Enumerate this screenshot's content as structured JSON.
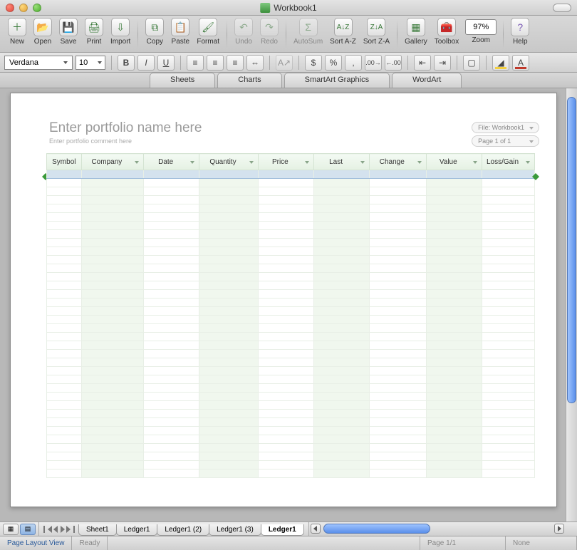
{
  "window": {
    "title": "Workbook1"
  },
  "toolbar": {
    "new": "New",
    "open": "Open",
    "save": "Save",
    "print": "Print",
    "import": "Import",
    "copy": "Copy",
    "paste": "Paste",
    "format": "Format",
    "undo": "Undo",
    "redo": "Redo",
    "autosum": "AutoSum",
    "sortaz": "Sort A-Z",
    "sortza": "Sort Z-A",
    "gallery": "Gallery",
    "toolbox": "Toolbox",
    "zoom": "Zoom",
    "zoom_value": "97%",
    "help": "Help"
  },
  "format": {
    "font_name": "Verdana",
    "font_size": "10"
  },
  "ribbon": {
    "sheets": "Sheets",
    "charts": "Charts",
    "smartart": "SmartArt Graphics",
    "wordart": "WordArt"
  },
  "portfolio": {
    "title_placeholder": "Enter portfolio name here",
    "comment_placeholder": "Enter portfolio comment here",
    "file_pill": "File: Workbook1",
    "page_pill": "Page 1 of 1"
  },
  "columns": {
    "symbol": "Symbol",
    "company": "Company",
    "date": "Date",
    "quantity": "Quantity",
    "price": "Price",
    "last": "Last",
    "change": "Change",
    "value": "Value",
    "lossgain": "Loss/Gain"
  },
  "sheets": {
    "tabs": [
      "Sheet1",
      "Ledger1",
      "Ledger1 (2)",
      "Ledger1 (3)",
      "Ledger1"
    ],
    "active_index": 4
  },
  "status": {
    "view": "Page Layout View",
    "ready": "Ready",
    "page": "Page 1/1",
    "right": "None"
  }
}
